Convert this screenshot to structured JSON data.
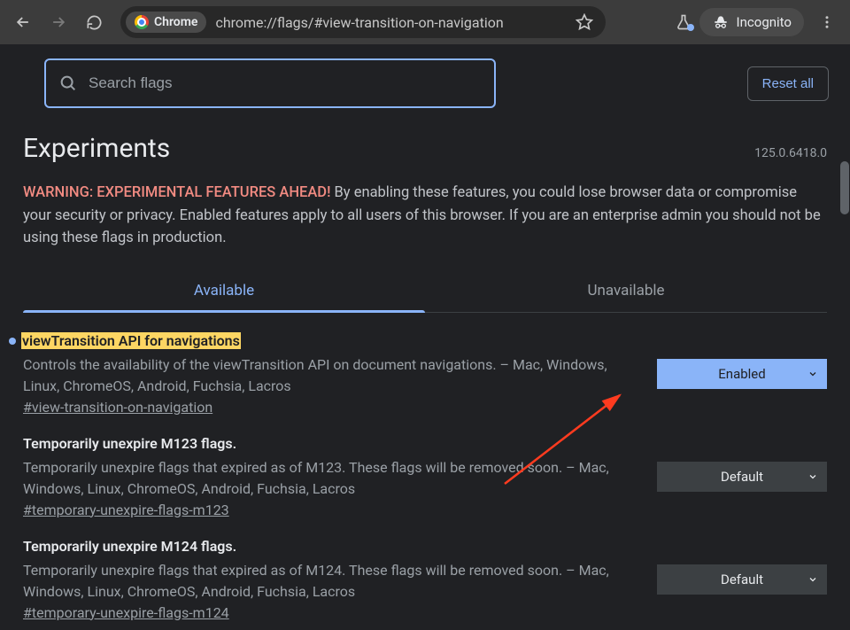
{
  "browser": {
    "chrome_chip": "Chrome",
    "url": "chrome://flags/#view-transition-on-navigation",
    "incognito_label": "Incognito"
  },
  "search": {
    "placeholder": "Search flags"
  },
  "reset_label": "Reset all",
  "header": {
    "title": "Experiments",
    "version": "125.0.6418.0"
  },
  "warning": {
    "lead": "WARNING: EXPERIMENTAL FEATURES AHEAD!",
    "body": " By enabling these features, you could lose browser data or compromise your security or privacy. Enabled features apply to all users of this browser. If you are an enterprise admin you should not be using these flags in production."
  },
  "tabs": {
    "available": "Available",
    "unavailable": "Unavailable"
  },
  "flags": [
    {
      "title": "viewTransition API for navigations",
      "desc": "Controls the availability of the viewTransition API on document navigations. – Mac, Windows, Linux, ChromeOS, Android, Fuchsia, Lacros",
      "anchor": "#view-transition-on-navigation",
      "select": "Enabled",
      "highlighted": true,
      "modified": true
    },
    {
      "title": "Temporarily unexpire M123 flags.",
      "desc": "Temporarily unexpire flags that expired as of M123. These flags will be removed soon. – Mac, Windows, Linux, ChromeOS, Android, Fuchsia, Lacros",
      "anchor": "#temporary-unexpire-flags-m123",
      "select": "Default",
      "highlighted": false,
      "modified": false
    },
    {
      "title": "Temporarily unexpire M124 flags.",
      "desc": "Temporarily unexpire flags that expired as of M124. These flags will be removed soon. – Mac, Windows, Linux, ChromeOS, Android, Fuchsia, Lacros",
      "anchor": "#temporary-unexpire-flags-m124",
      "select": "Default",
      "highlighted": false,
      "modified": false
    }
  ]
}
